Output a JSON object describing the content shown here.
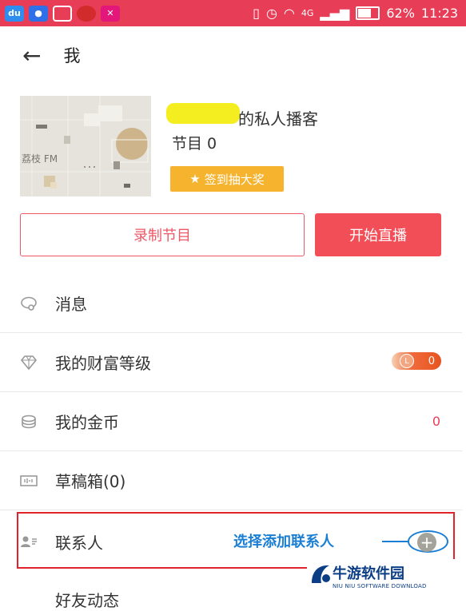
{
  "status_bar": {
    "network": "4G",
    "battery": "62%",
    "time": "11:23",
    "left_icons": [
      "baidu-cloud-icon",
      "baidu-paw-icon",
      "gallery-icon",
      "tomato-icon",
      "app-icon"
    ]
  },
  "header": {
    "title": "我"
  },
  "profile": {
    "cover_label": "荔枝 FM",
    "name_suffix": "的私人播客",
    "program_count": "节目 0",
    "signin_label": "签到抽大奖"
  },
  "actions": {
    "record": "录制节目",
    "live": "开始直播"
  },
  "menu": {
    "messages": "消息",
    "wealth": "我的财富等级",
    "wealth_value": "0",
    "wealth_level": "L",
    "coins": "我的金币",
    "coins_value": "0",
    "drafts": "草稿箱(0)",
    "contacts": "联系人",
    "next_partial": "好友动态"
  },
  "annotation": {
    "text": "选择添加联系人"
  },
  "watermark": {
    "title": "牛游软件园",
    "subtitle": "NIU NIU SOFTWARE DOWNLOAD"
  },
  "colors": {
    "accent": "#e83d57",
    "gold": "#f5b32e",
    "annotation": "#1a7fd4"
  }
}
